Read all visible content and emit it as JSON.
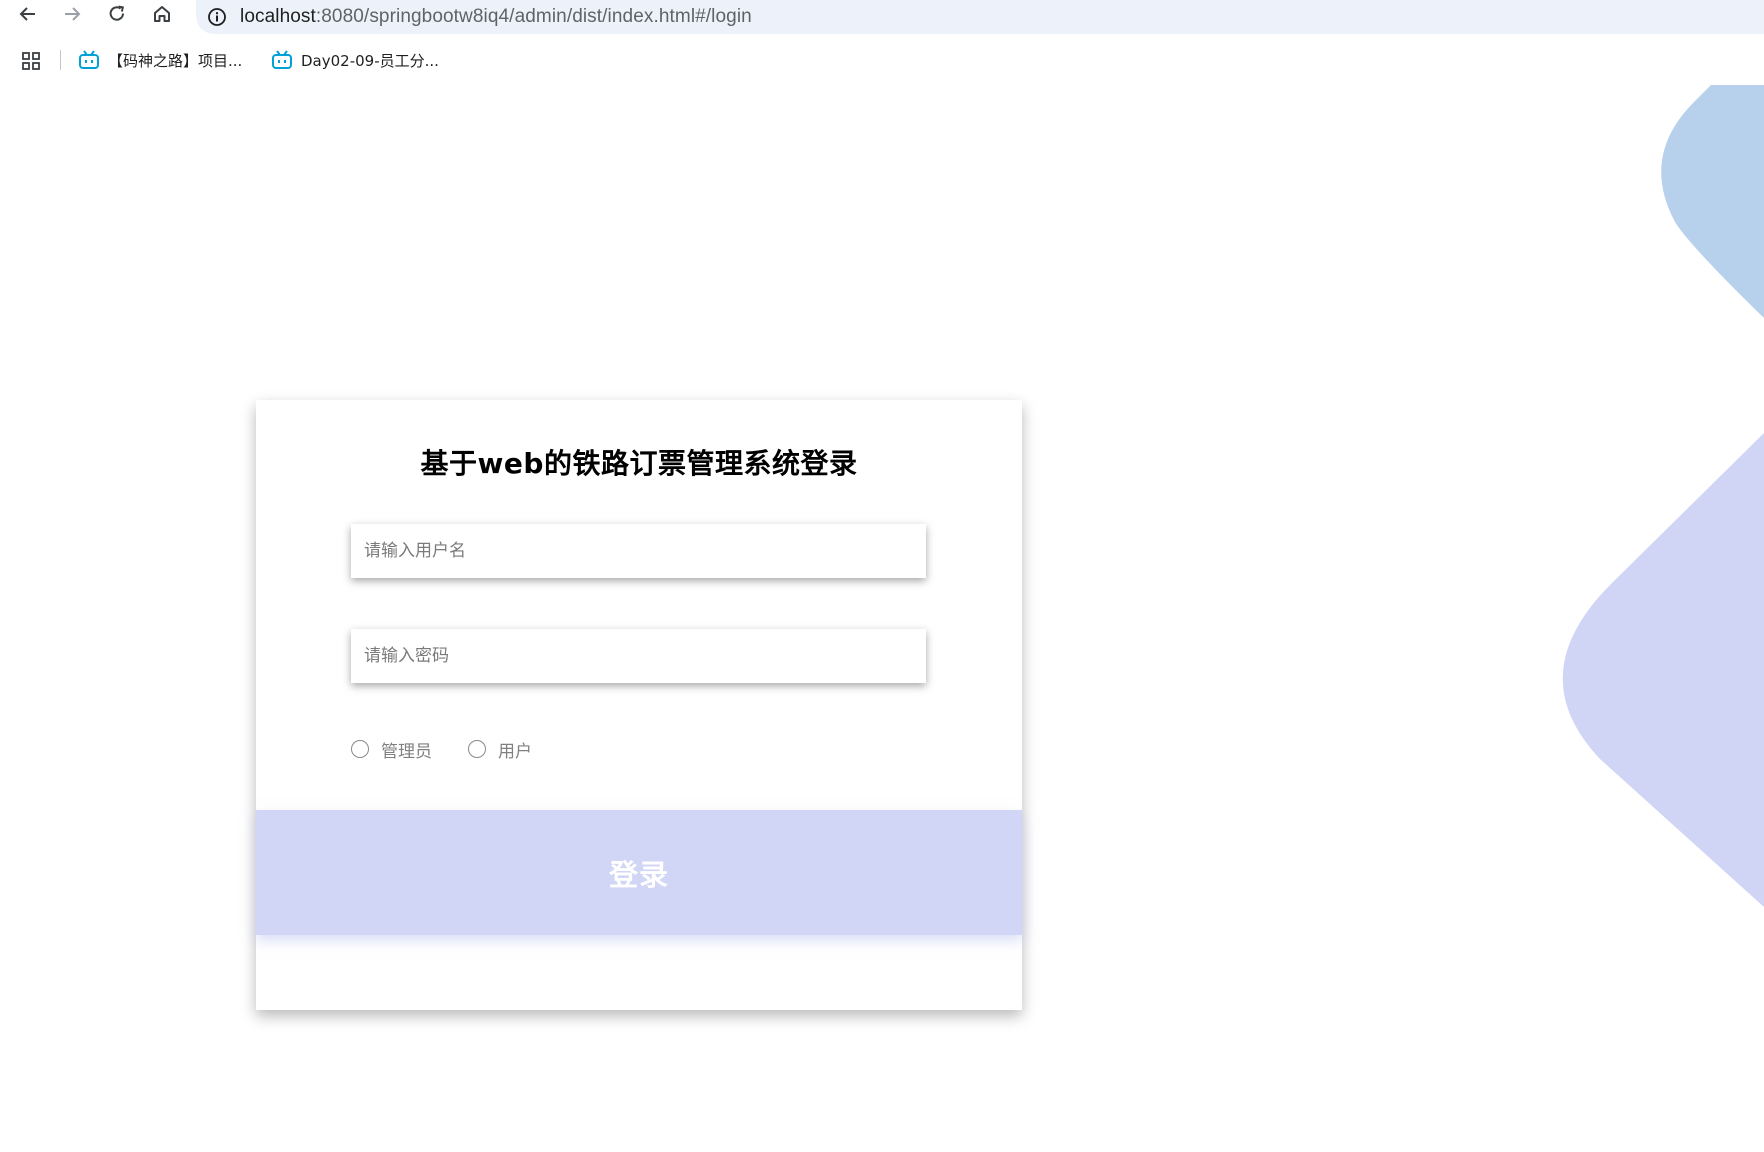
{
  "browser": {
    "url_host": "localhost",
    "url_path": ":8080/springbootw8iq4/admin/dist/index.html#/login",
    "bookmarks": [
      {
        "label": "【码神之路】项目...",
        "icon": "bilibili-tv-icon"
      },
      {
        "label": "Day02-09-员工分...",
        "icon": "bilibili-tv-icon"
      }
    ]
  },
  "login": {
    "title": "基于web的铁路订票管理系统登录",
    "username_placeholder": "请输入用户名",
    "password_placeholder": "请输入密码",
    "roles": [
      "管理员",
      "用户"
    ],
    "submit_label": "登录"
  },
  "colors": {
    "button": "#d1d5f6",
    "deco_blue": "#b7d0ec",
    "deco_lavender": "#d0d5f6"
  }
}
